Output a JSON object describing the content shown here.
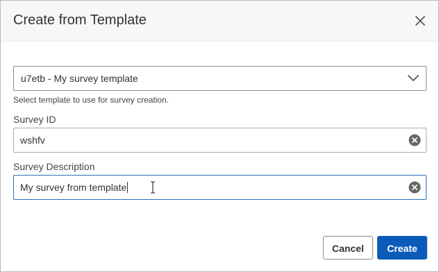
{
  "dialog": {
    "title": "Create from Template",
    "close_icon": "close-icon"
  },
  "template_select": {
    "value": "u7etb - My survey template",
    "help_text": "Select template to use for survey creation.",
    "icon": "chevron-down-icon"
  },
  "survey_id": {
    "label": "Survey ID",
    "value": "wshfv",
    "clear_icon": "clear-circle-icon"
  },
  "survey_description": {
    "label": "Survey Description",
    "value": "My survey from template",
    "clear_icon": "clear-circle-icon",
    "focused": true
  },
  "buttons": {
    "cancel_label": "Cancel",
    "create_label": "Create"
  },
  "colors": {
    "primary": "#0b5cba",
    "focus_border": "#2a6ebb",
    "header_bg": "#f7f7f7"
  }
}
